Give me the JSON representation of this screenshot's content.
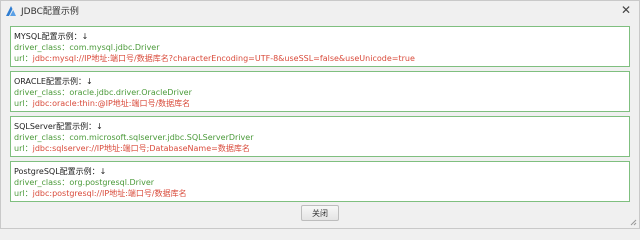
{
  "window": {
    "title": "JDBC配置示例",
    "close_glyph": "✕"
  },
  "groups": [
    {
      "heading": "MYSQL配置示例：↓",
      "driver_label": "driver_class：",
      "driver_value": "com.mysql.jdbc.Driver",
      "url_label": "url：",
      "url_value": "jdbc:mysql://IP地址:端口号/数据库名?characterEncoding=UTF-8&useSSL=false&useUnicode=true"
    },
    {
      "heading": "ORACLE配置示例：↓",
      "driver_label": "driver_class：",
      "driver_value": "oracle.jdbc.driver.OracleDriver",
      "url_label": "url：",
      "url_value": "jdbc:oracle:thin:@IP地址:端口号/数据库名"
    },
    {
      "heading": "SQLServer配置示例：↓",
      "driver_label": "driver_class：",
      "driver_value": "com.microsoft.sqlserver.jdbc.SQLServerDriver",
      "url_label": "url：",
      "url_value": "jdbc:sqlserver://IP地址:端口号;DatabaseName=数据库名"
    },
    {
      "heading": "PostgreSQL配置示例：↓",
      "driver_label": "driver_class：",
      "driver_value": "org.postgresql.Driver",
      "url_label": "url：",
      "url_value": "jdbc:postgresql://IP地址:端口号/数据库名"
    }
  ],
  "footer": {
    "close_label": "关闭"
  },
  "colors": {
    "label": "#4b9a3a",
    "value": "#d94a3a",
    "border": "#7fbf7f",
    "icon": "#2f7dd1"
  }
}
